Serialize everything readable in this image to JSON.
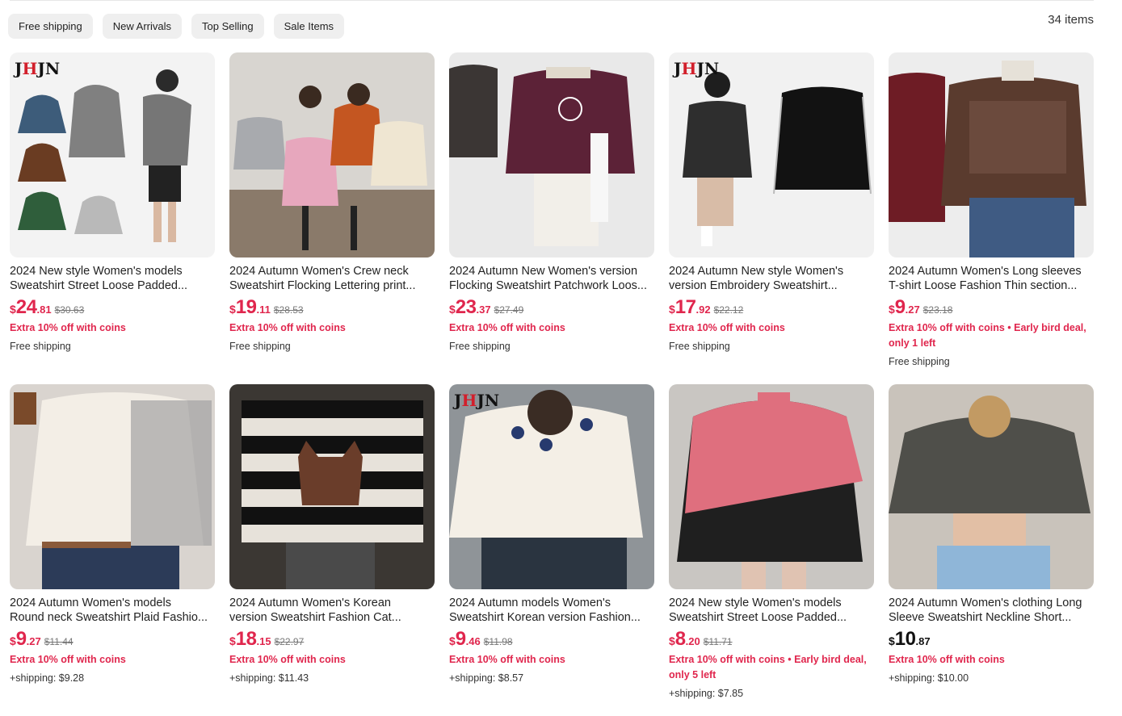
{
  "filters": [
    "Free shipping",
    "New Arrivals",
    "Top Selling",
    "Sale Items"
  ],
  "item_count": "34 items",
  "promo_line": "Extra 10% off with coins",
  "colors": {
    "accent": "#e0264d",
    "chip_bg": "#efefef"
  },
  "products": [
    {
      "title1": "2024 New style Women's models",
      "title2": "Sweatshirt Street Loose Padded...",
      "currency": "$",
      "price_int": "24",
      "price_dec": ".81",
      "orig": "$30.63",
      "promo": "Extra 10% off with coins",
      "promo2": "",
      "ship": "Free shipping",
      "logo": "JHJN"
    },
    {
      "title1": "2024 Autumn Women's Crew neck",
      "title2": "Sweatshirt Flocking Lettering print...",
      "currency": "$",
      "price_int": "19",
      "price_dec": ".11",
      "orig": "$28.53",
      "promo": "Extra 10% off with coins",
      "promo2": "",
      "ship": "Free shipping",
      "logo": ""
    },
    {
      "title1": "2024 Autumn New Women's version",
      "title2": "Flocking Sweatshirt Patchwork Loos...",
      "currency": "$",
      "price_int": "23",
      "price_dec": ".37",
      "orig": "$27.49",
      "promo": "Extra 10% off with coins",
      "promo2": "",
      "ship": "Free shipping",
      "logo": ""
    },
    {
      "title1": "2024 Autumn New style Women's",
      "title2": "version Embroidery Sweatshirt...",
      "currency": "$",
      "price_int": "17",
      "price_dec": ".92",
      "orig": "$22.12",
      "promo": "Extra 10% off with coins",
      "promo2": "",
      "ship": "Free shipping",
      "logo": "JHJN"
    },
    {
      "title1": "2024 Autumn Women's Long sleeves",
      "title2": "T-shirt Loose Fashion Thin section...",
      "currency": "$",
      "price_int": "9",
      "price_dec": ".27",
      "orig": "$23.18",
      "promo": "Extra 10% off with coins • Early bird deal,",
      "promo2": "only 1 left",
      "ship": "Free shipping",
      "logo": ""
    },
    {
      "title1": "2024 Autumn Women's models",
      "title2": "Round neck Sweatshirt Plaid Fashio...",
      "currency": "$",
      "price_int": "9",
      "price_dec": ".27",
      "orig": "$11.44",
      "promo": "Extra 10% off with coins",
      "promo2": "",
      "ship": "+shipping: $9.28",
      "logo": ""
    },
    {
      "title1": "2024 Autumn Women's Korean",
      "title2": "version Sweatshirt Fashion Cat...",
      "currency": "$",
      "price_int": "18",
      "price_dec": ".15",
      "orig": "$22.97",
      "promo": "Extra 10% off with coins",
      "promo2": "",
      "ship": "+shipping: $11.43",
      "logo": ""
    },
    {
      "title1": "2024 Autumn models Women's",
      "title2": "Sweatshirt Korean version Fashion...",
      "currency": "$",
      "price_int": "9",
      "price_dec": ".46",
      "orig": "$11.98",
      "promo": "Extra 10% off with coins",
      "promo2": "",
      "ship": "+shipping: $8.57",
      "logo": "JHJN"
    },
    {
      "title1": "2024 New style Women's models",
      "title2": "Sweatshirt Street Loose Padded...",
      "currency": "$",
      "price_int": "8",
      "price_dec": ".20",
      "orig": "$11.71",
      "promo": "Extra 10% off with coins • Early bird deal,",
      "promo2": "only 5 left",
      "ship": "+shipping: $7.85",
      "logo": ""
    },
    {
      "title1": "2024 Autumn Women's clothing Long",
      "title2": "Sleeve Sweatshirt Neckline Short...",
      "currency": "$",
      "price_int": "10",
      "price_dec": ".87",
      "orig": "",
      "promo": "Extra 10% off with coins",
      "promo2": "",
      "ship": "+shipping: $10.00",
      "logo": ""
    }
  ]
}
